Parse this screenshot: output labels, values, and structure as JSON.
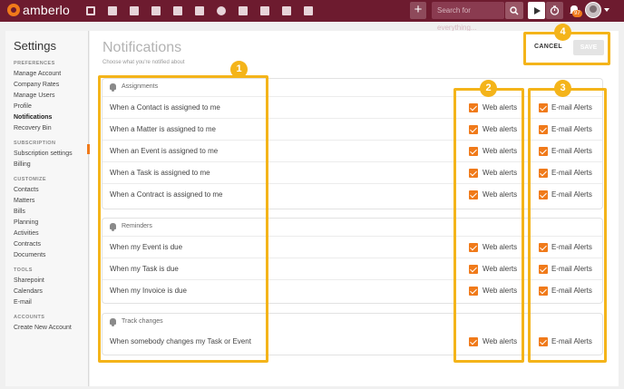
{
  "topbar": {
    "logo_text": "amberlo",
    "search_placeholder": "Search for everything...",
    "plus_label": "+",
    "notification_count": "97",
    "nav_icons": [
      "dashboard-icon",
      "contacts-icon",
      "matters-icon",
      "documents-icon",
      "billing-icon",
      "calendar-icon",
      "time-icon",
      "folder-icon",
      "files-icon",
      "email-icon",
      "reports-icon"
    ]
  },
  "sidebar": {
    "title": "Settings",
    "sections": [
      {
        "heading": "PREFERENCES",
        "items": [
          "Manage Account",
          "Company Rates",
          "Manage Users",
          "Profile",
          "Notifications",
          "Recovery Bin"
        ]
      },
      {
        "heading": "SUBSCRIPTION",
        "items": [
          "Subscription settings",
          "Billing"
        ]
      },
      {
        "heading": "CUSTOMIZE",
        "items": [
          "Contacts",
          "Matters",
          "Bills",
          "Planning",
          "Activities",
          "Contracts",
          "Documents"
        ]
      },
      {
        "heading": "TOOLS",
        "items": [
          "Sharepoint",
          "Calendars",
          "E-mail"
        ]
      },
      {
        "heading": "ACCOUNTS",
        "items": [
          "Create New Account"
        ]
      }
    ],
    "active_item": "Notifications"
  },
  "main": {
    "title": "Notifications",
    "subtitle": "Choose what you're notified about",
    "cancel_label": "CANCEL",
    "save_label": "SAVE",
    "web_label": "Web alerts",
    "email_label": "E-mail Alerts",
    "groups": [
      {
        "heading": "Assignments",
        "rows": [
          {
            "label": "When a Contact is assigned to me",
            "web": true,
            "email": true
          },
          {
            "label": "When a Matter is assigned to me",
            "web": true,
            "email": true
          },
          {
            "label": "When an Event is assigned to me",
            "web": true,
            "email": true
          },
          {
            "label": "When a Task is assigned to me",
            "web": true,
            "email": true
          },
          {
            "label": "When a Contract is assigned to me",
            "web": true,
            "email": true
          }
        ]
      },
      {
        "heading": "Reminders",
        "rows": [
          {
            "label": "When my Event is due",
            "web": true,
            "email": true
          },
          {
            "label": "When my Task is due",
            "web": true,
            "email": true
          },
          {
            "label": "When my Invoice is due",
            "web": true,
            "email": true
          }
        ]
      },
      {
        "heading": "Track changes",
        "rows": [
          {
            "label": "When somebody changes my Task or Event",
            "web": true,
            "email": true
          }
        ]
      }
    ]
  },
  "annotations": [
    "1",
    "2",
    "3",
    "4"
  ],
  "colors": {
    "topbar": "#6d1b2f",
    "accent": "#f07a1a",
    "annotation": "#f4b41a"
  }
}
